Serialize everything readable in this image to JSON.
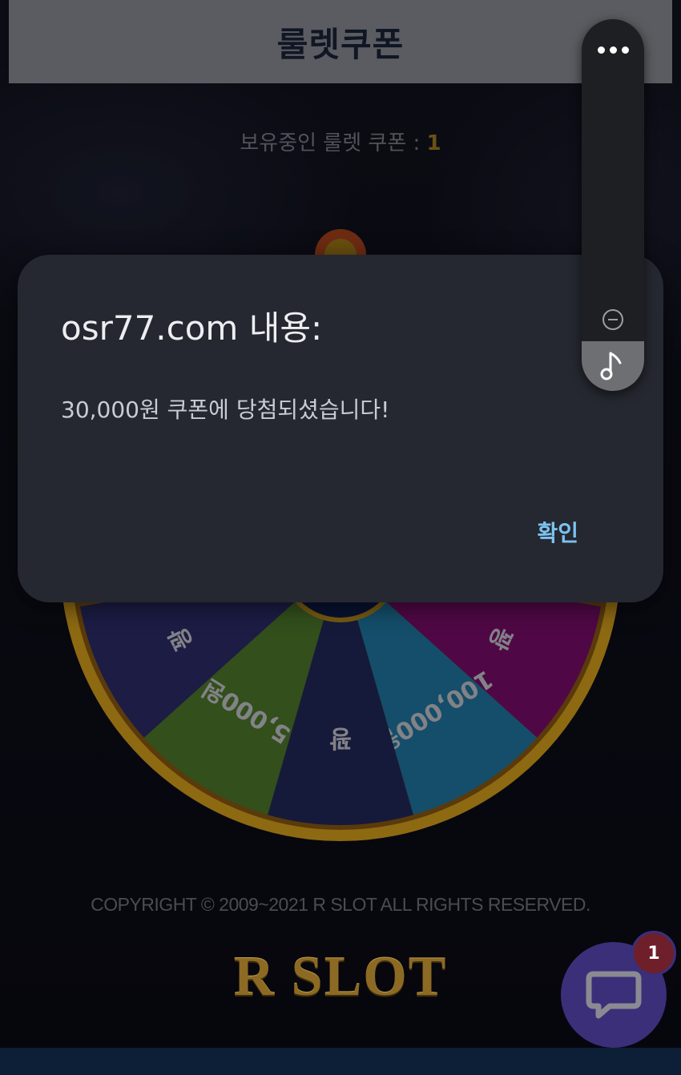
{
  "page": {
    "title": "룰렛쿠폰",
    "coupon_label": "보유중인 룰렛 쿠폰 : ",
    "coupon_count": "1",
    "copyright": "COPYRIGHT © 2009~2021 R SLOT ALL RIGHTS RESERVED.",
    "logo_text": "R SLOT"
  },
  "wheel": {
    "segments": [
      {
        "label": "꽝",
        "color": "#2c2b6b"
      },
      {
        "label": "5,000원",
        "color": "#4d7a2c"
      },
      {
        "label": "꽝",
        "color": "#22295a"
      },
      {
        "label": "100,000원",
        "color": "#1f79a3"
      },
      {
        "label": "꽝",
        "color": "#7a0d6b"
      }
    ],
    "rim_color": "#d9a11c"
  },
  "dialog": {
    "title": "osr77.com 내용:",
    "message": "30,000원 쿠폰에 당첨되셨습니다!",
    "ok_label": "확인"
  },
  "side_panel": {
    "icons": [
      "more-icon",
      "minimize-icon",
      "music-note-icon"
    ]
  },
  "chat": {
    "badge_count": "1",
    "icon": "chat-bubble-icon"
  }
}
